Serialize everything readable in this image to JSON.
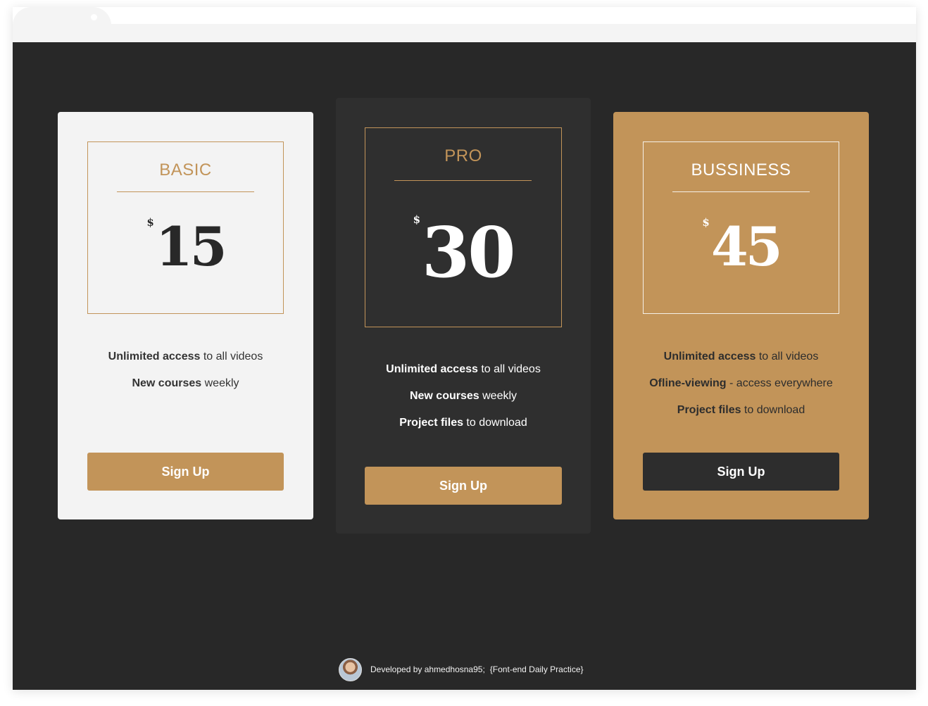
{
  "plans": [
    {
      "name": "BASIC",
      "currency": "$",
      "price": "15",
      "features": [
        {
          "bold": "Unlimited access",
          "rest": " to all videos"
        },
        {
          "bold": "New courses",
          "rest": " weekly"
        }
      ],
      "button": "Sign Up"
    },
    {
      "name": "PRO",
      "currency": "$",
      "price": "30",
      "features": [
        {
          "bold": "Unlimited access",
          "rest": " to all videos"
        },
        {
          "bold": "New courses",
          "rest": " weekly"
        },
        {
          "bold": "Project files",
          "rest": " to download"
        }
      ],
      "button": "Sign Up"
    },
    {
      "name": "BUSSINESS",
      "currency": "$",
      "price": "45",
      "features": [
        {
          "bold": "Unlimited access",
          "rest": " to all videos"
        },
        {
          "bold": "Ofline-viewing",
          "rest": " - access everywhere"
        },
        {
          "bold": "Project files",
          "rest": " to download"
        }
      ],
      "button": "Sign Up"
    }
  ],
  "footer": {
    "developer": "Developed by ahmedhosna95;",
    "tagline": "{Font-end Daily Practice}"
  },
  "colors": {
    "accent": "#c29459",
    "background": "#282828",
    "pro_card": "#2f2f2f",
    "basic_card": "#f3f3f3",
    "dark_button": "#2d2d2d"
  },
  "icons": {
    "avatar": "developer-avatar"
  }
}
